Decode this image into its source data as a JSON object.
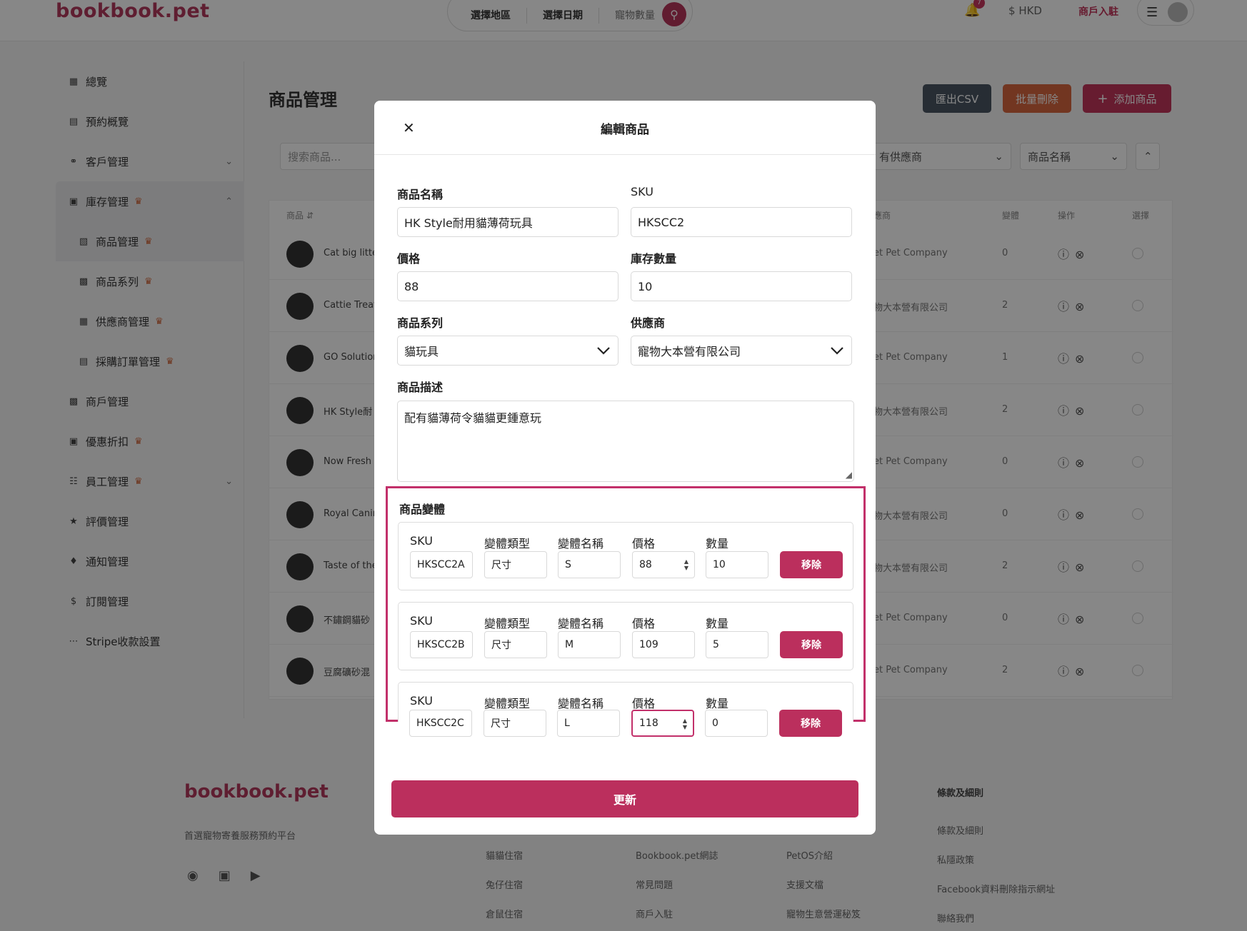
{
  "brand": {
    "logo": "bookbook.pet"
  },
  "topbar": {
    "search_segments": [
      "選擇地區",
      "選擇日期",
      "寵物數量"
    ],
    "notification_count": "7",
    "currency": "HKD",
    "merchant_link": "商戶入駐"
  },
  "sidebar": {
    "items": [
      {
        "label": "總覽",
        "icon": "dashboard-icon"
      },
      {
        "label": "預約概覽",
        "icon": "calendar-icon"
      },
      {
        "label": "客戶管理",
        "icon": "headset-icon"
      },
      {
        "label": "庫存管理",
        "icon": "store-icon"
      },
      {
        "label": "商品管理",
        "icon": "boxes-icon"
      },
      {
        "label": "商品系列",
        "icon": "archive-icon"
      },
      {
        "label": "供應商管理",
        "icon": "factory-icon"
      },
      {
        "label": "採購訂單管理",
        "icon": "calendar-icon"
      },
      {
        "label": "商戶管理",
        "icon": "shop-icon"
      },
      {
        "label": "優惠折扣",
        "icon": "ticket-icon"
      },
      {
        "label": "員工管理",
        "icon": "org-icon"
      },
      {
        "label": "評價管理",
        "icon": "star-icon"
      },
      {
        "label": "通知管理",
        "icon": "bell-icon"
      },
      {
        "label": "訂閱管理",
        "icon": "dollar-icon"
      },
      {
        "label": "Stripe收款設置",
        "icon": "stripe-icon"
      }
    ]
  },
  "content": {
    "title": "商品管理",
    "buttons": {
      "export": "匯出CSV",
      "bulk_delete": "批量刪除",
      "add": "添加商品"
    },
    "search_placeholder": "搜索商品...",
    "filters": {
      "supplier": "有供應商",
      "sort": "商品名稱"
    },
    "headers": {
      "product": "商品",
      "supplier": "應商",
      "variants": "變體",
      "actions": "操作",
      "select": "選擇"
    },
    "rows": [
      {
        "name": "Cat big litte",
        "supplier": "et Pet Company",
        "variants": "0"
      },
      {
        "name": "Cattie Treat",
        "supplier": "物大本營有限公司",
        "variants": "2"
      },
      {
        "name": "GO Solution",
        "supplier": "et Pet Company",
        "variants": "1"
      },
      {
        "name": "HK Style耐",
        "supplier": "物大本營有限公司",
        "variants": "2"
      },
      {
        "name": "Now Fresh",
        "supplier": "et Pet Company",
        "variants": "0"
      },
      {
        "name": "Royal Canin",
        "supplier": "物大本營有限公司",
        "variants": "0"
      },
      {
        "name": "Taste of the",
        "supplier": "物大本營有限公司",
        "variants": "2"
      },
      {
        "name": "不鏽鋼貓砂",
        "supplier": "et Pet Company",
        "variants": "0"
      },
      {
        "name": "豆腐礦砂混",
        "supplier": "et Pet Company",
        "variants": "2"
      }
    ]
  },
  "footer": {
    "logo": "bookbook.pet",
    "tagline": "首選寵物寄養服務預約平台",
    "col1": [
      "貓貓住宿",
      "兔仔住宿",
      "倉鼠住宿"
    ],
    "col2": [
      "Bookbook.pet網誌",
      "常見問題",
      "商戶入駐"
    ],
    "col3": [
      "PetOS介紹",
      "支援文檔",
      "寵物生意營運秘笈"
    ],
    "col4_title": "條款及細則",
    "col4": [
      "條款及細則",
      "私隱政策",
      "Facebook資料刪除指示網址",
      "聯絡我們"
    ]
  },
  "modal": {
    "title": "編輯商品",
    "fields": {
      "name_label": "商品名稱",
      "name_value": "HK Style耐用貓薄荷玩具",
      "sku_label": "SKU",
      "sku_value": "HKSCC2",
      "price_label": "價格",
      "price_value": "88",
      "stock_label": "庫存數量",
      "stock_value": "10",
      "series_label": "商品系列",
      "series_value": "貓玩具",
      "supplier_label": "供應商",
      "supplier_value": "寵物大本營有限公司",
      "desc_label": "商品描述",
      "desc_value": "配有貓薄荷令貓貓更鍾意玩"
    },
    "variants_title": "商品變體",
    "variant_labels": {
      "sku": "SKU",
      "type": "變體類型",
      "name": "變體名稱",
      "price": "價格",
      "qty": "數量",
      "remove": "移除"
    },
    "variants": [
      {
        "sku": "HKSCC2A",
        "type": "尺寸",
        "name": "S",
        "price": "88",
        "qty": "10"
      },
      {
        "sku": "HKSCC2B",
        "type": "尺寸",
        "name": "M",
        "price": "109",
        "qty": "5"
      },
      {
        "sku": "HKSCC2C",
        "type": "尺寸",
        "name": "L",
        "price": "118",
        "qty": "0"
      }
    ],
    "update_button": "更新"
  },
  "colors": {
    "brand": "#b43a5e",
    "primary_button": "#bb2f5d",
    "highlight_border": "#c2306a",
    "export_button": "#4a5563",
    "bulk_delete_button": "#d8663f"
  }
}
